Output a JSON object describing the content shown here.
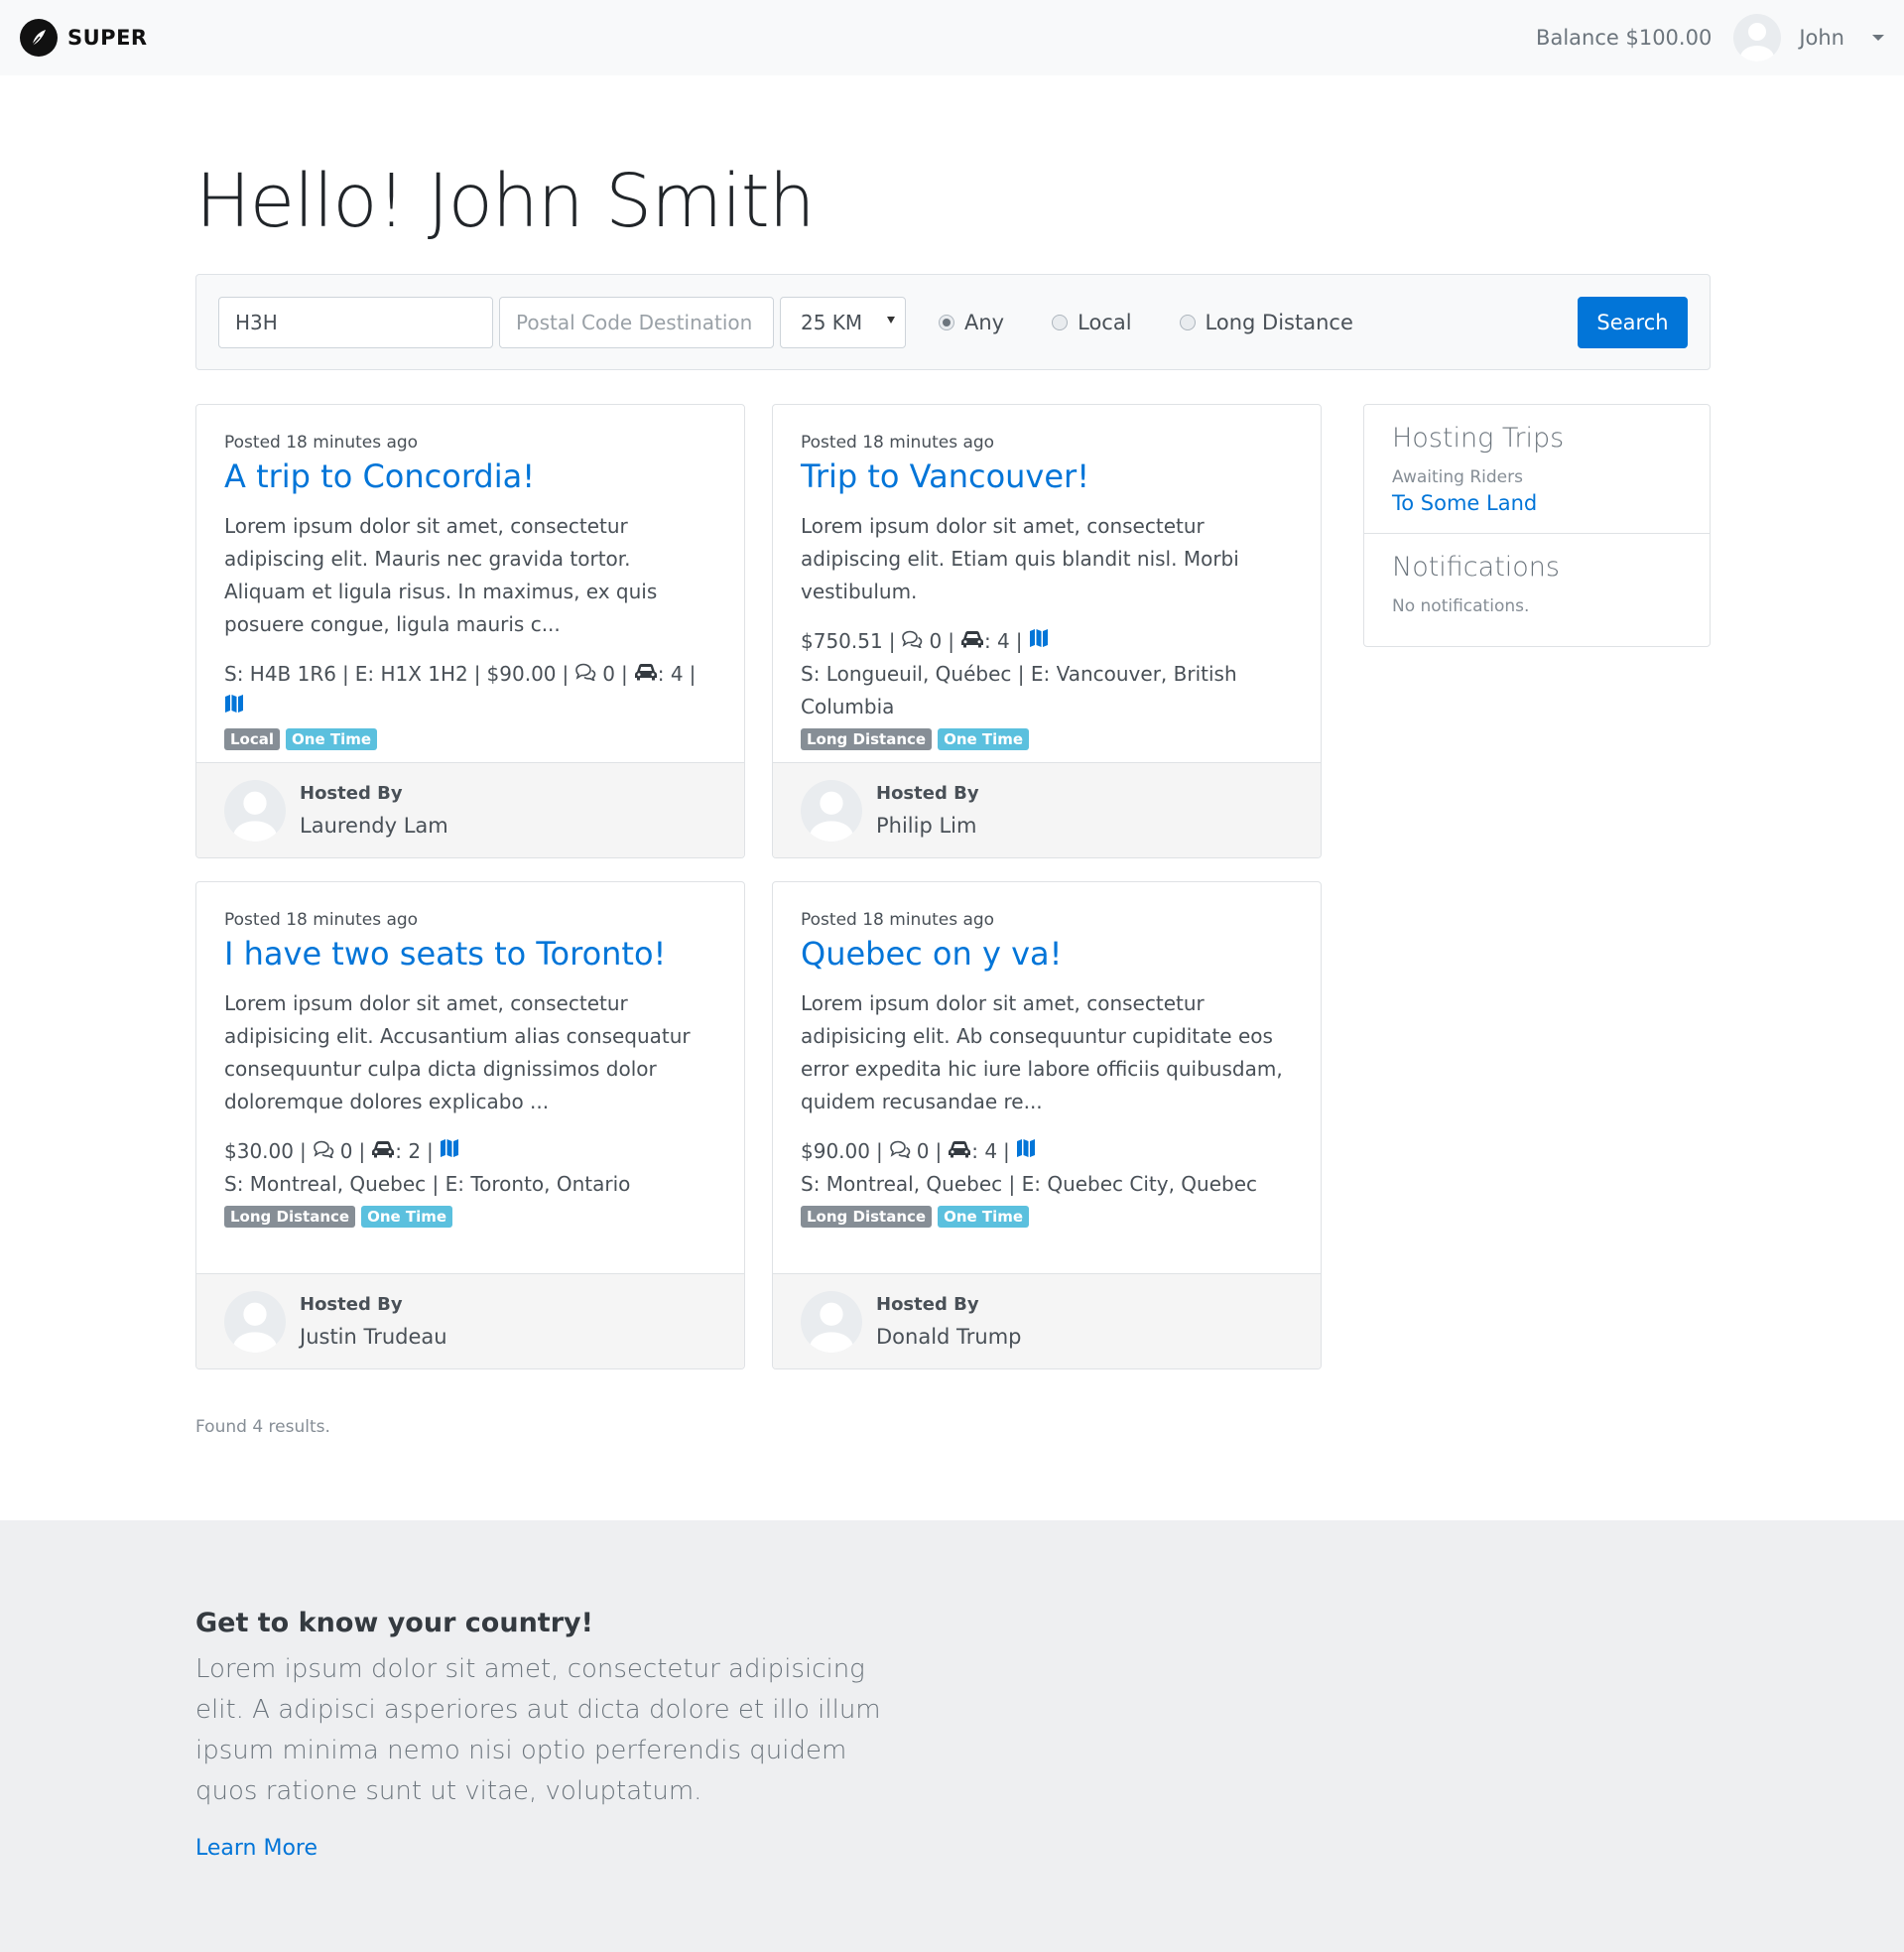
{
  "navbar": {
    "brand": "SUPER",
    "balance": "Balance $100.00",
    "user_name": "John"
  },
  "greeting": "Hello! John Smith",
  "search": {
    "origin_value": "H3H",
    "destination_placeholder": "Postal Code Destination (",
    "distance_value": "25 KM",
    "radios": [
      "Any",
      "Local",
      "Long Distance"
    ],
    "selected_radio": "Any",
    "search_label": "Search"
  },
  "trips": [
    {
      "posted": "Posted 18 minutes ago",
      "title": "A trip to Concordia!",
      "description": "Lorem ipsum dolor sit amet, consectetur adipiscing elit. Mauris nec gravida tortor. Aliquam et ligula risus. In maximus, ex quis posuere congue, ligula mauris c...",
      "start": "S: H4B 1R6",
      "end": "E: H1X 1H2",
      "price": "$90.00",
      "comments": "0",
      "seats": ": 4",
      "badges": [
        "Local",
        "One Time"
      ],
      "host_label": "Hosted By",
      "host": "Laurendy Lam"
    },
    {
      "posted": "Posted 18 minutes ago",
      "title": "Trip to Vancouver!",
      "description": "Lorem ipsum dolor sit amet, consectetur adipiscing elit. Etiam quis blandit nisl. Morbi vestibulum.",
      "price": "$750.51",
      "comments": "0",
      "seats": ": 4",
      "location": "S: Longueuil, Québec | E: Vancouver, British Columbia",
      "badges": [
        "Long Distance",
        "One Time"
      ],
      "host_label": "Hosted By",
      "host": "Philip Lim"
    },
    {
      "posted": "Posted 18 minutes ago",
      "title": "I have two seats to Toronto!",
      "description": "Lorem ipsum dolor sit amet, consectetur adipisicing elit. Accusantium alias consequatur consequuntur culpa dicta dignissimos dolor doloremque dolores explicabo ...",
      "price": "$30.00",
      "comments": "0",
      "seats": ": 2",
      "location": "S: Montreal, Quebec | E: Toronto, Ontario",
      "badges": [
        "Long Distance",
        "One Time"
      ],
      "host_label": "Hosted By",
      "host": "Justin Trudeau"
    },
    {
      "posted": "Posted 18 minutes ago",
      "title": "Quebec on y va!",
      "description": "Lorem ipsum dolor sit amet, consectetur adipisicing elit. Ab consequuntur cupiditate eos error expedita hic iure labore officiis quibusdam, quidem recusandae re...",
      "price": "$90.00",
      "comments": "0",
      "seats": ": 4",
      "location": "S: Montreal, Quebec | E: Quebec City, Quebec",
      "badges": [
        "Long Distance",
        "One Time"
      ],
      "host_label": "Hosted By",
      "host": "Donald Trump"
    }
  ],
  "sidebar": {
    "hosting_title": "Hosting Trips",
    "hosting_status": "Awaiting Riders",
    "hosting_trip": "To Some Land",
    "notifications_title": "Notifications",
    "notifications_empty": "No notifications."
  },
  "results": "Found 4 results.",
  "footer": {
    "title": "Get to know your country!",
    "text": "Lorem ipsum dolor sit amet, consectetur adipisicing elit. A adipisci asperiores aut dicta dolore et illo illum ipsum minima nemo nisi optio perferendis quidem quos ratione sunt ut vitae, voluptatum.",
    "link": "Learn More"
  },
  "colors": {
    "primary": "#0275d8",
    "badge_grey": "#868e96",
    "badge_info": "#5bc0de",
    "navbar_bg": "#f8f9fa",
    "footer_bg": "#eeeff1"
  },
  "icons": {
    "brand": "feather-icon",
    "comments": "comments-icon",
    "seats": "car-icon",
    "map": "map-icon",
    "avatar": "user-avatar-icon"
  }
}
